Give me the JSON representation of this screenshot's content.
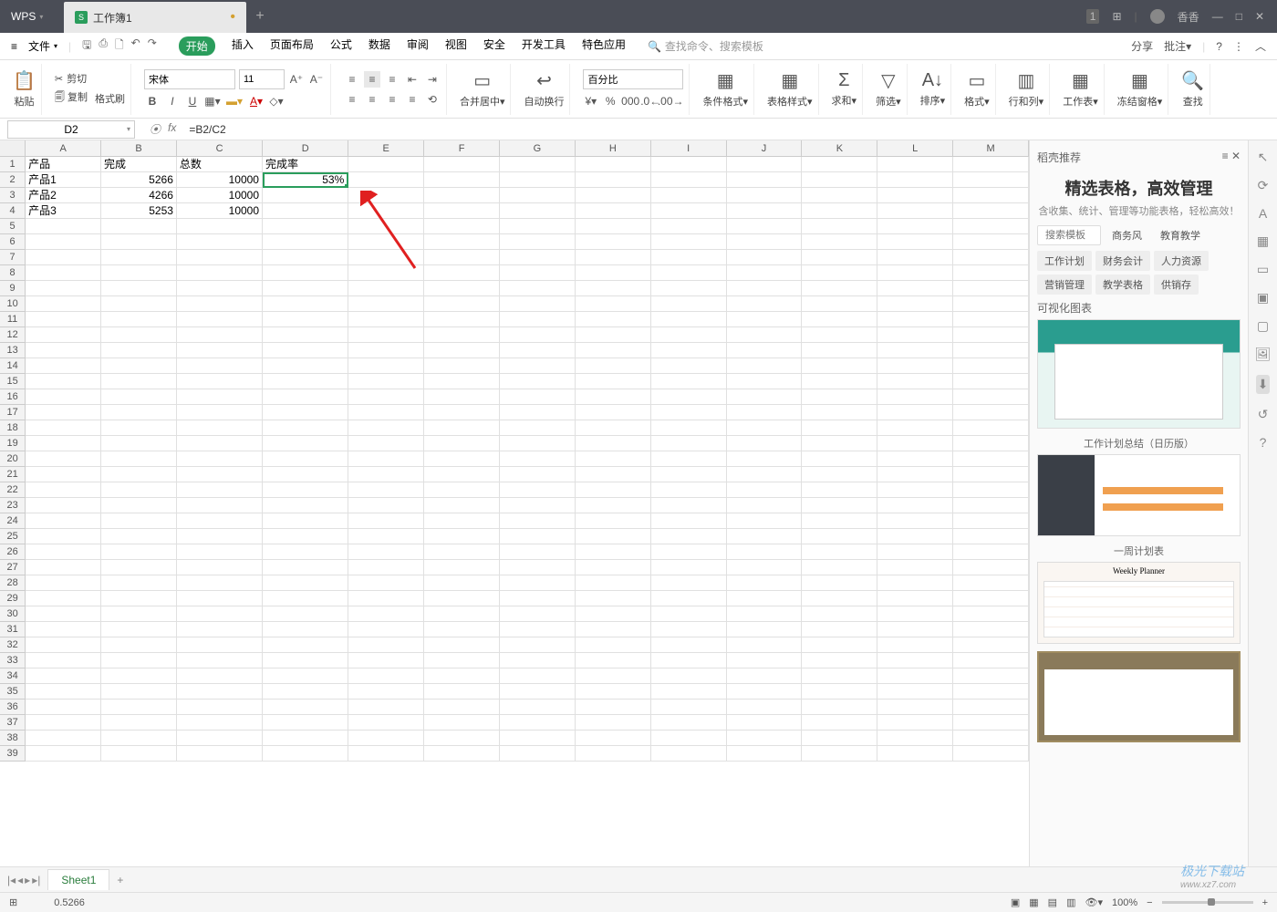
{
  "title": {
    "wps": "WPS",
    "workbook": "工作簿1"
  },
  "titlebar_right": {
    "badge": "1",
    "user": "香香"
  },
  "menubar": {
    "file": "文件",
    "tabs": [
      "开始",
      "插入",
      "页面布局",
      "公式",
      "数据",
      "审阅",
      "视图",
      "安全",
      "开发工具",
      "特色应用"
    ],
    "search_placeholder": "查找命令、搜索模板",
    "share": "分享",
    "comment": "批注"
  },
  "ribbon": {
    "paste": "粘贴",
    "cut": "剪切",
    "copy": "复制",
    "fmt_painter": "格式刷",
    "font": "宋体",
    "size": "11",
    "merge": "合并居中",
    "wrap": "自动换行",
    "numfmt": "百分比",
    "cond_fmt": "条件格式",
    "table_style": "表格样式",
    "sum": "求和",
    "filter": "筛选",
    "sort": "排序",
    "format": "格式",
    "rowcol": "行和列",
    "sheet": "工作表",
    "freeze": "冻结窗格",
    "find": "查找"
  },
  "formula": {
    "cell": "D2",
    "value": "=B2/C2"
  },
  "columns": [
    "A",
    "B",
    "C",
    "D",
    "E",
    "F",
    "G",
    "H",
    "I",
    "J",
    "K",
    "L",
    "M"
  ],
  "sheet": {
    "headers": {
      "a": "产品",
      "b": "完成",
      "c": "总数",
      "d": "完成率"
    },
    "rows": [
      {
        "a": "产品1",
        "b": "5266",
        "c": "10000",
        "d": "53%"
      },
      {
        "a": "产品2",
        "b": "4266",
        "c": "10000",
        "d": ""
      },
      {
        "a": "产品3",
        "b": "5253",
        "c": "10000",
        "d": ""
      }
    ]
  },
  "side": {
    "header": "稻壳推荐",
    "title": "精选表格，高效管理",
    "sub": "含收集、统计、管理等功能表格，轻松高效！",
    "search_ph": "搜索模板",
    "tags_top": [
      "商务风",
      "教育教学"
    ],
    "tags": [
      "工作计划",
      "财务会计",
      "人力资源",
      "营销管理",
      "教学表格",
      "供销存"
    ],
    "section": "可视化图表",
    "thumb2_label": "工作计划总结（日历版）",
    "thumb3_label": "一周计划表",
    "thumb3_inner": "Weekly  Planner"
  },
  "sheet_tabs": {
    "name": "Sheet1"
  },
  "status": {
    "value": "0.5266",
    "zoom": "100%"
  },
  "watermark": {
    "main": "极光下载站",
    "sub": "www.xz7.com"
  }
}
